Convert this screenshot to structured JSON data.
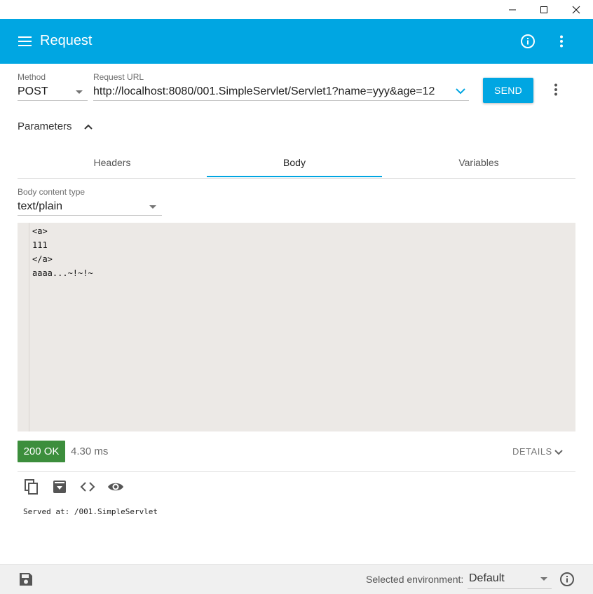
{
  "window": {
    "minimize_glyph": "—",
    "maximize_glyph": "☐",
    "close_glyph": "✕"
  },
  "appbar": {
    "title": "Request",
    "menu_icon": "hamburger-menu-icon",
    "info_icon": "info-icon",
    "more_icon": "more-vert-icon",
    "color": "#00a6e2"
  },
  "request": {
    "method_label": "Method",
    "method_value": "POST",
    "url_label": "Request URL",
    "url_value": "http://localhost:8080/001.SimpleServlet/Servlet1?name=yyy&age=12",
    "send_label": "SEND"
  },
  "parameters": {
    "label": "Parameters",
    "tabs": [
      {
        "label": "Headers",
        "active": false
      },
      {
        "label": "Body",
        "active": true
      },
      {
        "label": "Variables",
        "active": false
      }
    ],
    "body_content_type_label": "Body content type",
    "body_content_type_value": "text/plain",
    "body_lines": [
      "<a>",
      "111",
      "</a>",
      "aaaa...~!~!~"
    ]
  },
  "response": {
    "status": "200 OK",
    "status_color": "#3c8e3c",
    "timing": "4.30 ms",
    "details_label": "DETAILS",
    "icons": [
      "copy-icon",
      "save-response-icon",
      "code-view-icon",
      "preview-eye-icon"
    ],
    "body_text": "Served at: /001.SimpleServlet"
  },
  "footer": {
    "env_label": "Selected environment:",
    "env_value": "Default",
    "save_icon": "save-icon",
    "info_icon": "info-icon"
  }
}
